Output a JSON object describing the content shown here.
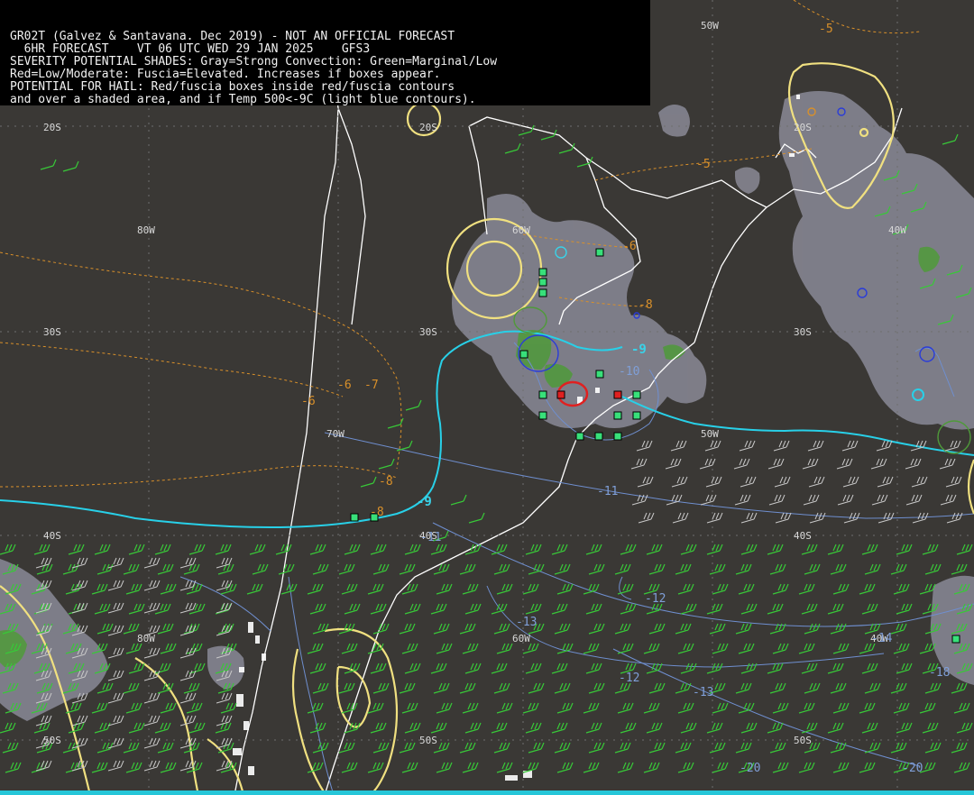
{
  "header": {
    "lines": [
      "GR02T (Galvez & Santavana. Dec 2019) - NOT AN OFFICIAL FORECAST",
      "  6HR FORECAST    VT 06 UTC WED 29 JAN 2025    GFS3",
      "SEVERITY POTENTIAL SHADES: Gray=Strong Convection: Green=Marginal/Low",
      "Red=Low/Moderate: Fuscia=Elevated. Increases if boxes appear.",
      "POTENTIAL FOR HAIL: Red/fuscia boxes inside red/fuscia contours",
      "and over a shaded area, and if Temp 500<-9C (light blue contours)."
    ]
  },
  "grid_labels": {
    "lat": [
      "20S",
      "20S",
      "20S",
      "30S",
      "30S",
      "30S",
      "40S",
      "40S",
      "40S",
      "50S",
      "50S",
      "50S"
    ],
    "lon": [
      "50W",
      "80W",
      "60W",
      "40W",
      "70W",
      "50W",
      "80W",
      "60W",
      "40W"
    ]
  },
  "temperature_labels": {
    "orange": [
      "-5",
      "-5",
      "-6",
      "-8",
      "-6",
      "-6",
      "-7",
      "-8",
      "-8"
    ],
    "blue": [
      "-10",
      "-11",
      "-12",
      "-13",
      "-12",
      "-13",
      "-14",
      "-18",
      "-20",
      "-20",
      "-11"
    ],
    "cyan": [
      "-9",
      "-9"
    ]
  },
  "colors": {
    "background": "#3a3835",
    "coastline": "#ffffff",
    "severity_gray": "#8a8a96",
    "marginal_green": "#4f9a3a",
    "hail_box_green": "#38e07a",
    "hail_box_red": "#e02020",
    "contour_yellow": "#f0e080",
    "contour_orange": "#d9902a",
    "contour_blue": "#5b7fd0",
    "contour_cyan": "#28d0e8",
    "wind_barb_green": "#38c838",
    "wind_barb_gray": "#c8c8c8"
  }
}
